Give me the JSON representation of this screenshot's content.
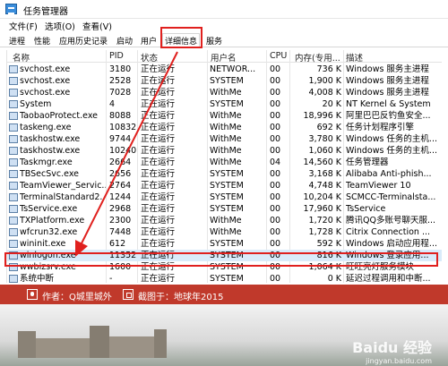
{
  "window": {
    "title": "任务管理器"
  },
  "menu": [
    "文件(F)",
    "选项(O)",
    "查看(V)"
  ],
  "tabs": [
    {
      "label": "进程",
      "active": false
    },
    {
      "label": "性能",
      "active": false
    },
    {
      "label": "应用历史记录",
      "active": false
    },
    {
      "label": "启动",
      "active": false
    },
    {
      "label": "用户",
      "active": false
    },
    {
      "label": "详细信息",
      "active": true
    },
    {
      "label": "服务",
      "active": false
    }
  ],
  "columns": {
    "name": "名称",
    "pid": "PID",
    "status": "状态",
    "user": "用户名",
    "cpu": "CPU",
    "mem": "内存(专用...",
    "desc": "描述"
  },
  "rows": [
    {
      "name": "svchost.exe",
      "pid": "3180",
      "status": "正在运行",
      "user": "NETWOR...",
      "cpu": "00",
      "mem": "736 K",
      "desc": "Windows 服务主进程"
    },
    {
      "name": "svchost.exe",
      "pid": "2528",
      "status": "正在运行",
      "user": "SYSTEM",
      "cpu": "00",
      "mem": "1,900 K",
      "desc": "Windows 服务主进程"
    },
    {
      "name": "svchost.exe",
      "pid": "7028",
      "status": "正在运行",
      "user": "WithMe",
      "cpu": "00",
      "mem": "4,008 K",
      "desc": "Windows 服务主进程"
    },
    {
      "name": "System",
      "pid": "4",
      "status": "正在运行",
      "user": "SYSTEM",
      "cpu": "00",
      "mem": "20 K",
      "desc": "NT Kernel & System"
    },
    {
      "name": "TaobaoProtect.exe",
      "pid": "8088",
      "status": "正在运行",
      "user": "WithMe",
      "cpu": "00",
      "mem": "18,996 K",
      "desc": "阿里巴巴反钓鱼安全..."
    },
    {
      "name": "taskeng.exe",
      "pid": "10832",
      "status": "正在运行",
      "user": "WithMe",
      "cpu": "00",
      "mem": "692 K",
      "desc": "任务计划程序引擎"
    },
    {
      "name": "taskhostw.exe",
      "pid": "9744",
      "status": "正在运行",
      "user": "WithMe",
      "cpu": "00",
      "mem": "3,780 K",
      "desc": "Windows 任务的主机..."
    },
    {
      "name": "taskhostw.exe",
      "pid": "10240",
      "status": "正在运行",
      "user": "WithMe",
      "cpu": "00",
      "mem": "1,060 K",
      "desc": "Windows 任务的主机..."
    },
    {
      "name": "Taskmgr.exe",
      "pid": "2664",
      "status": "正在运行",
      "user": "WithMe",
      "cpu": "04",
      "mem": "14,560 K",
      "desc": "任务管理器"
    },
    {
      "name": "TBSecSvc.exe",
      "pid": "2656",
      "status": "正在运行",
      "user": "SYSTEM",
      "cpu": "00",
      "mem": "3,168 K",
      "desc": "Alibaba Anti-phish..."
    },
    {
      "name": "TeamViewer_Servic...",
      "pid": "2764",
      "status": "正在运行",
      "user": "SYSTEM",
      "cpu": "00",
      "mem": "4,748 K",
      "desc": "TeamViewer 10"
    },
    {
      "name": "TerminalStandard2...",
      "pid": "1244",
      "status": "正在运行",
      "user": "SYSTEM",
      "cpu": "00",
      "mem": "10,204 K",
      "desc": "SCMCC-Terminalsta..."
    },
    {
      "name": "TsService.exe",
      "pid": "2968",
      "status": "正在运行",
      "user": "SYSTEM",
      "cpu": "00",
      "mem": "17,960 K",
      "desc": "TsService"
    },
    {
      "name": "TXPlatform.exe",
      "pid": "2300",
      "status": "正在运行",
      "user": "WithMe",
      "cpu": "00",
      "mem": "1,720 K",
      "desc": "腾讯QQ多账号聊天服..."
    },
    {
      "name": "wfcrun32.exe",
      "pid": "7448",
      "status": "正在运行",
      "user": "WithMe",
      "cpu": "00",
      "mem": "1,728 K",
      "desc": "Citrix Connection ..."
    },
    {
      "name": "wininit.exe",
      "pid": "612",
      "status": "正在运行",
      "user": "SYSTEM",
      "cpu": "00",
      "mem": "592 K",
      "desc": "Windows 启动应用程..."
    },
    {
      "name": "winlogon.exe",
      "pid": "11352",
      "status": "正在运行",
      "user": "SYSTEM",
      "cpu": "00",
      "mem": "816 K",
      "desc": "Windows 登录应用..."
    },
    {
      "name": "wwbizsrv.exe",
      "pid": "1600",
      "status": "正在运行",
      "user": "SYSTEM",
      "cpu": "00",
      "mem": "1,064 K",
      "desc": "旺旺亮灯服务模块"
    },
    {
      "name": "系统中断",
      "pid": "-",
      "status": "正在运行",
      "user": "SYSTEM",
      "cpu": "00",
      "mem": "0 K",
      "desc": "延迟过程调用和中断..."
    }
  ],
  "selected_row": 16,
  "banner": {
    "author": "作者：Q城里城外",
    "screenshot": "截图于：地球年2015"
  },
  "watermark": {
    "brand": "Baidu 经验",
    "url": "jingyan.baidu.com"
  },
  "colors": {
    "highlight": "#e0201e",
    "banner": "#c0392b",
    "selection": "#d9ebfa"
  }
}
